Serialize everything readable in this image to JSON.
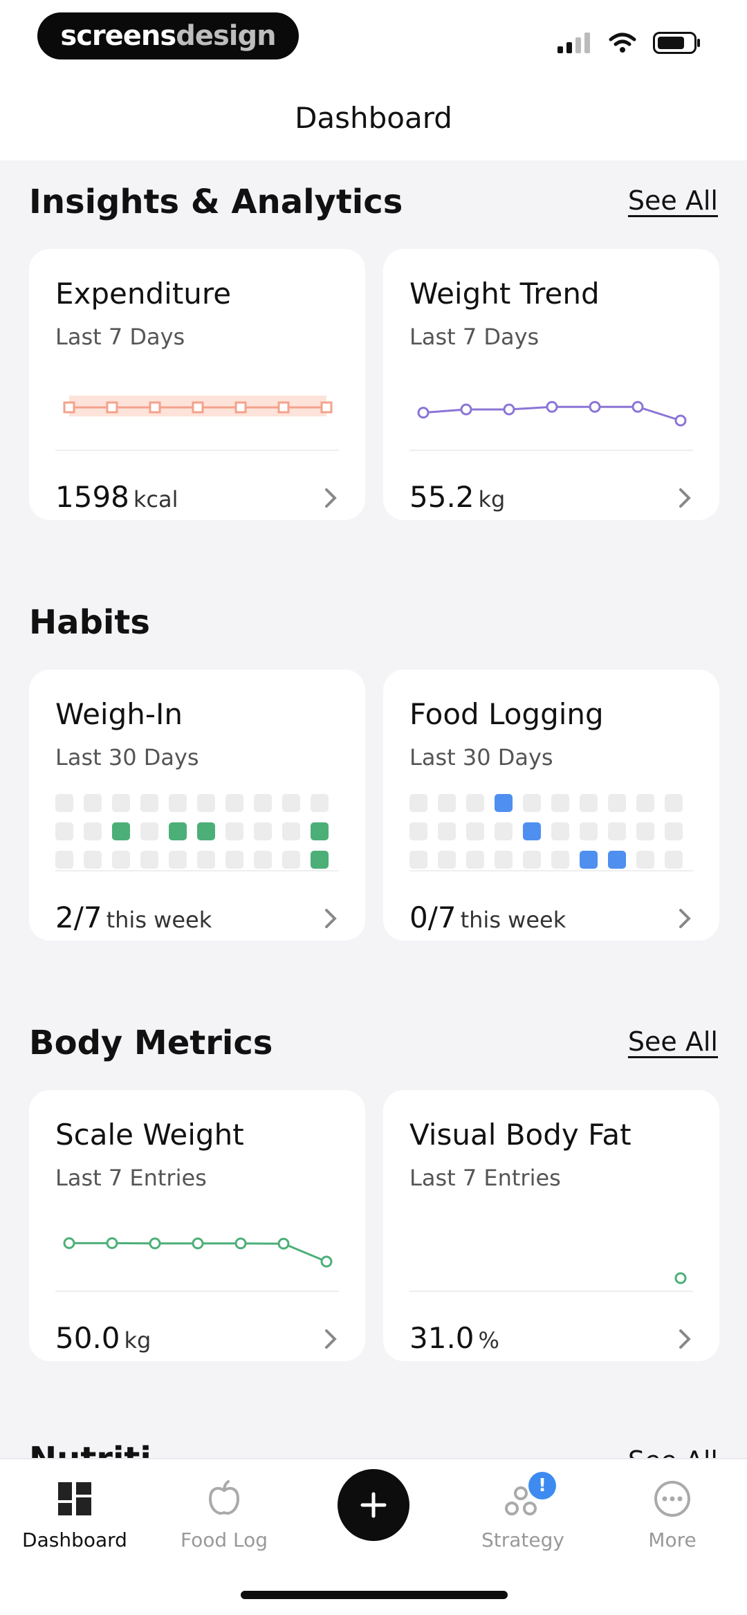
{
  "brand": {
    "part1": "screens",
    "part2": "design"
  },
  "header": {
    "title": "Dashboard"
  },
  "sections": {
    "insights": {
      "title": "Insights & Analytics",
      "see_all": "See All",
      "cards": [
        {
          "title": "Expenditure",
          "subtitle": "Last 7 Days",
          "value": "1598",
          "unit": "kcal"
        },
        {
          "title": "Weight Trend",
          "subtitle": "Last 7 Days",
          "value": "55.2",
          "unit": "kg"
        }
      ]
    },
    "habits": {
      "title": "Habits",
      "cards": [
        {
          "title": "Weigh-In",
          "subtitle": "Last 30 Days",
          "value": "2/7",
          "unit": "this week"
        },
        {
          "title": "Food Logging",
          "subtitle": "Last 30 Days",
          "value": "0/7",
          "unit": "this week"
        }
      ]
    },
    "body_metrics": {
      "title": "Body Metrics",
      "see_all": "See All",
      "cards": [
        {
          "title": "Scale Weight",
          "subtitle": "Last 7 Entries",
          "value": "50.0",
          "unit": "kg"
        },
        {
          "title": "Visual Body Fat",
          "subtitle": "Last 7 Entries",
          "value": "31.0",
          "unit": "%"
        }
      ]
    },
    "nutrition_peek": {
      "title": "Nutriti",
      "see_all": "See All"
    }
  },
  "charts": {
    "expenditure": [
      1598,
      1598,
      1598,
      1598,
      1598,
      1598,
      1598
    ],
    "weight_trend": [
      0.3,
      0.42,
      0.42,
      0.52,
      0.52,
      0.52,
      0.0
    ],
    "scale_weight": [
      0.7,
      0.7,
      0.69,
      0.69,
      0.69,
      0.68,
      0.0
    ],
    "visual_body_fat": [
      31.0
    ],
    "weigh_in_days": [
      0,
      0,
      0,
      0,
      0,
      0,
      0,
      0,
      0,
      0,
      0,
      0,
      1,
      0,
      1,
      1,
      0,
      0,
      0,
      1,
      0,
      0,
      0,
      0,
      0,
      0,
      0,
      0,
      0,
      1
    ],
    "food_logging_days": [
      0,
      0,
      0,
      2,
      0,
      0,
      0,
      0,
      0,
      0,
      0,
      0,
      0,
      0,
      2,
      0,
      0,
      0,
      0,
      0,
      0,
      0,
      0,
      0,
      0,
      0,
      2,
      2,
      0,
      0
    ]
  },
  "colors": {
    "expenditure": "#f4a28c",
    "weight_trend": "#8b74d6",
    "green": "#4caf78",
    "blue": "#4e8ff0"
  },
  "tabbar": {
    "tabs": [
      {
        "label": "Dashboard",
        "icon": "dashboard-icon"
      },
      {
        "label": "Food Log",
        "icon": "apple-icon"
      },
      {
        "label": "Strategy",
        "icon": "strategy-icon",
        "badge": "!"
      },
      {
        "label": "More",
        "icon": "more-icon"
      }
    ]
  }
}
